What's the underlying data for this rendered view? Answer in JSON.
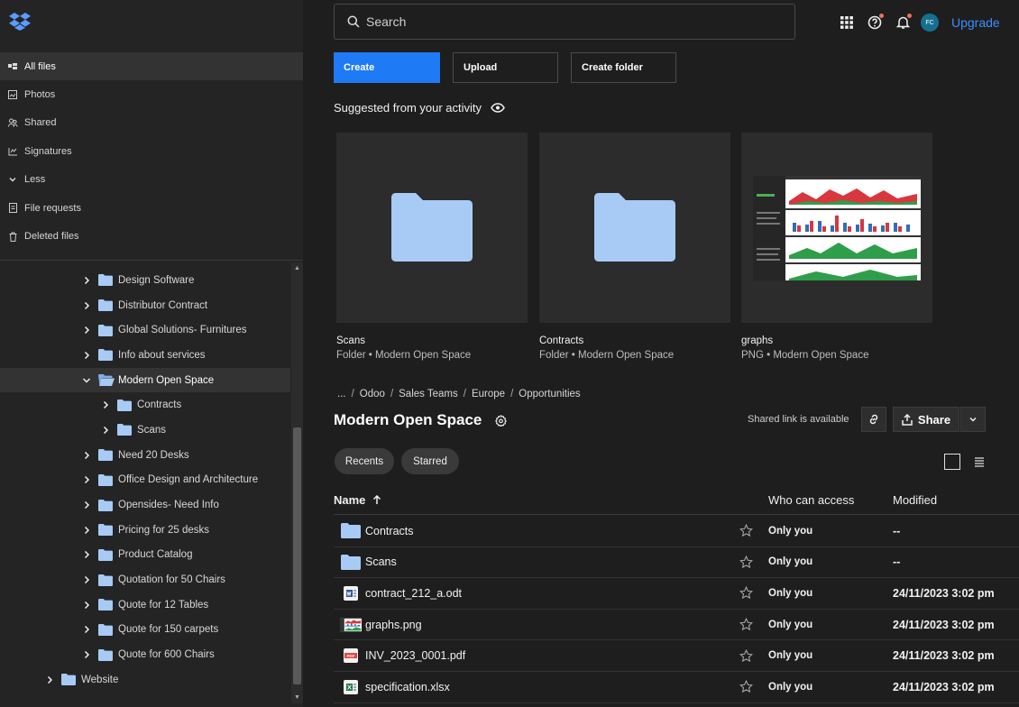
{
  "sidebar": {
    "nav": [
      {
        "label": "All files",
        "icon": "all-files-icon",
        "active": true
      },
      {
        "label": "Photos",
        "icon": "photos-icon"
      },
      {
        "label": "Shared",
        "icon": "shared-icon"
      },
      {
        "label": "Signatures",
        "icon": "signatures-icon"
      },
      {
        "label": "Less",
        "icon": "chevron-down-icon"
      },
      {
        "label": "File requests",
        "icon": "file-requests-icon"
      },
      {
        "label": "Deleted files",
        "icon": "trash-icon"
      }
    ],
    "tree": [
      {
        "label": "Design Software"
      },
      {
        "label": "Distributor Contract"
      },
      {
        "label": "Global Solutions- Furnitures"
      },
      {
        "label": "Info about services"
      },
      {
        "label": "Modern Open Space",
        "expanded": true,
        "selected": true
      },
      {
        "label": "Contracts",
        "child": true
      },
      {
        "label": "Scans",
        "child": true
      },
      {
        "label": "Need 20 Desks"
      },
      {
        "label": "Office Design and Architecture"
      },
      {
        "label": "Opensides- Need Info"
      },
      {
        "label": "Pricing for 25 desks"
      },
      {
        "label": "Product Catalog"
      },
      {
        "label": "Quotation for 50 Chairs"
      },
      {
        "label": "Quote for 12 Tables"
      },
      {
        "label": "Quote for 150 carpets"
      },
      {
        "label": "Quote for 600 Chairs"
      },
      {
        "label": "Website",
        "top": true
      }
    ]
  },
  "topbar": {
    "search_placeholder": "Search",
    "avatar_initials": "FC",
    "upgrade_label": "Upgrade"
  },
  "actions": {
    "create": "Create",
    "upload": "Upload",
    "create_folder": "Create folder"
  },
  "suggested": {
    "title": "Suggested from your activity",
    "cards": [
      {
        "name": "Scans",
        "sub": "Folder • Modern Open Space",
        "kind": "folder"
      },
      {
        "name": "Contracts",
        "sub": "Folder • Modern Open Space",
        "kind": "folder"
      },
      {
        "name": "graphs",
        "sub": "PNG • Modern Open Space",
        "kind": "image"
      }
    ]
  },
  "breadcrumb": [
    "...",
    "Odoo",
    "Sales Teams",
    "Europe",
    "Opportunities"
  ],
  "folder": {
    "title": "Modern Open Space",
    "shared_text": "Shared link is available",
    "share_label": "Share"
  },
  "filters": {
    "recents": "Recents",
    "starred": "Starred"
  },
  "table": {
    "col_name": "Name",
    "col_access": "Who can access",
    "col_modified": "Modified",
    "rows": [
      {
        "name": "Contracts",
        "type": "folder",
        "access": "Only you",
        "modified": "--"
      },
      {
        "name": "Scans",
        "type": "folder",
        "access": "Only you",
        "modified": "--"
      },
      {
        "name": "contract_212_a.odt",
        "type": "odt",
        "access": "Only you",
        "modified": "24/11/2023 3:02 pm"
      },
      {
        "name": "graphs.png",
        "type": "png",
        "access": "Only you",
        "modified": "24/11/2023 3:02 pm"
      },
      {
        "name": "INV_2023_0001.pdf",
        "type": "pdf",
        "access": "Only you",
        "modified": "24/11/2023 3:02 pm"
      },
      {
        "name": "specification.xlsx",
        "type": "xlsx",
        "access": "Only you",
        "modified": "24/11/2023 3:02 pm"
      }
    ]
  },
  "colors": {
    "accent": "#1f7af5",
    "folder": "#a7cbf5",
    "link": "#3b8eff"
  }
}
